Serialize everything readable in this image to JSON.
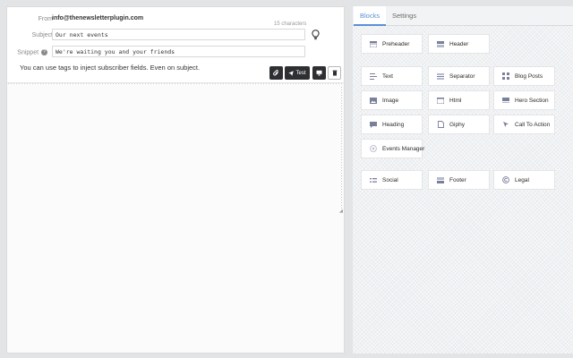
{
  "header": {
    "from_label": "From",
    "from_value": "info@thenewsletterplugin.com",
    "char_count": "15 characters",
    "subject_label": "Subject",
    "subject_value": "Our next events",
    "snippet_label": "Snippet",
    "snippet_value": "We're waiting you and your friends",
    "hint": "You can use tags to inject subscriber fields. Even on subject."
  },
  "toolbar": {
    "test_label": "Test"
  },
  "tabs": [
    {
      "label": "Blocks",
      "active": true
    },
    {
      "label": "Settings",
      "active": false
    }
  ],
  "blocks": [
    {
      "label": "Preheader",
      "icon": "preheader-icon"
    },
    {
      "label": "Header",
      "icon": "header-icon"
    },
    {
      "label": "Text",
      "icon": "text-icon"
    },
    {
      "label": "Separator",
      "icon": "separator-icon"
    },
    {
      "label": "Blog Posts",
      "icon": "blog-posts-icon"
    },
    {
      "label": "Image",
      "icon": "image-icon"
    },
    {
      "label": "Html",
      "icon": "html-icon"
    },
    {
      "label": "Hero Section",
      "icon": "hero-section-icon"
    },
    {
      "label": "Heading",
      "icon": "heading-icon"
    },
    {
      "label": "Giphy",
      "icon": "giphy-icon"
    },
    {
      "label": "Call To Action",
      "icon": "call-to-action-icon"
    },
    {
      "label": "Events Manager",
      "icon": "events-manager-icon"
    },
    {
      "label": "Social",
      "icon": "social-icon"
    },
    {
      "label": "Footer",
      "icon": "footer-icon"
    },
    {
      "label": "Legal",
      "icon": "legal-icon"
    }
  ],
  "colors": {
    "accent": "#5a8fd6",
    "dark_button": "#2d2f33",
    "icon": "#7a7f9a"
  }
}
